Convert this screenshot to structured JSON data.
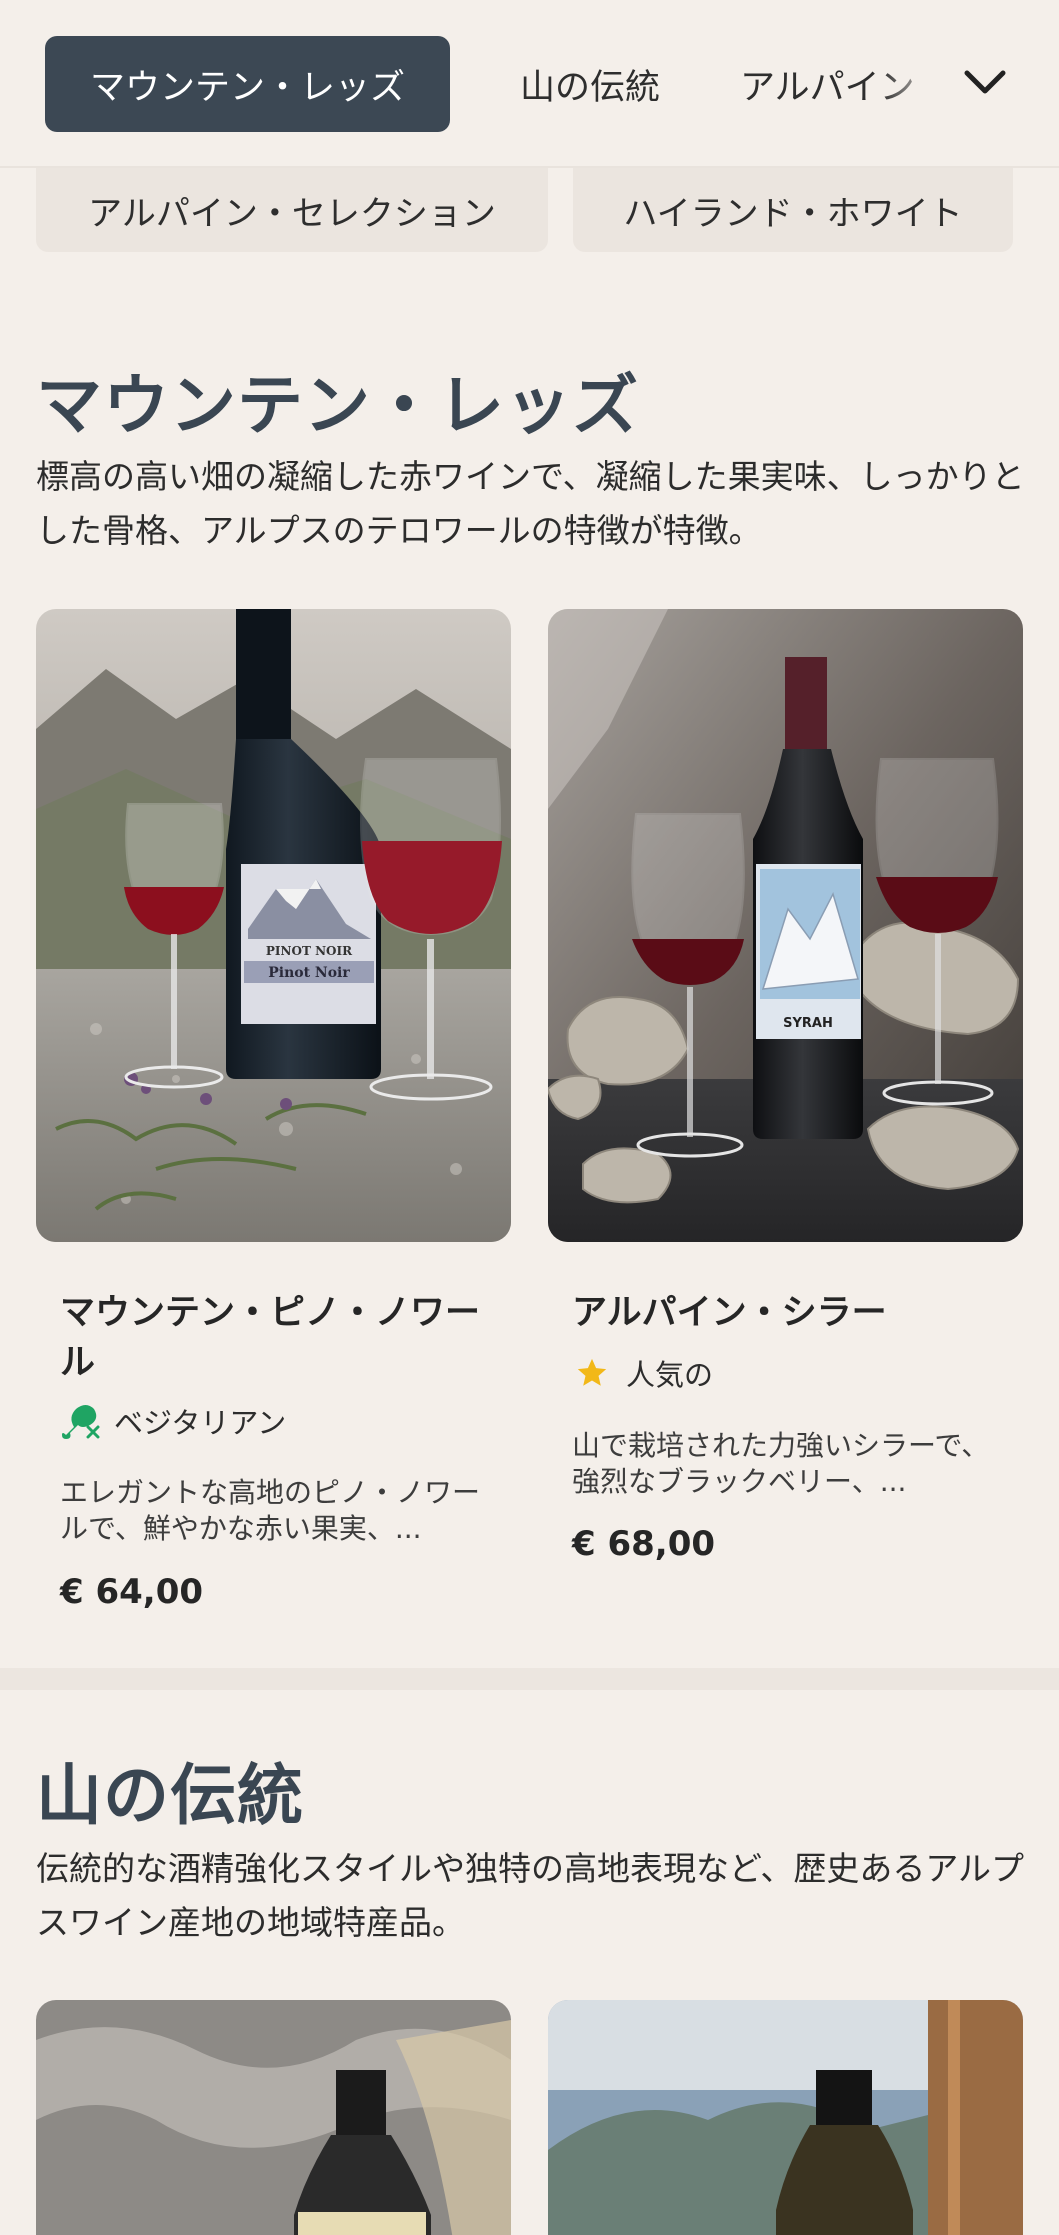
{
  "nav": {
    "tabs": [
      {
        "label": "マウンテン・レッズ",
        "active": true
      },
      {
        "label": "山の伝統",
        "active": false
      },
      {
        "label": "アルパイン",
        "active": false
      }
    ],
    "expand_icon": "chevron-down-icon"
  },
  "chips": [
    {
      "label": "アルパイン・セレクション"
    },
    {
      "label": "ハイランド・ホワイト"
    }
  ],
  "sections": [
    {
      "title": "マウンテン・レッズ",
      "description": "標高の高い畑の凝縮した赤ワインで、凝縮した果実味、しっかりとした骨格、アルプスのテロワールの特徴が特徴。",
      "products": [
        {
          "name": "マウンテン・ピノ・ノワール",
          "tag": "ベジタリアン",
          "tag_icon": "vegetarian-drumstick-icon",
          "description": "エレガントな高地のピノ・ノワールで、鮮やかな赤い果実、...",
          "price": "€ 64,00",
          "label_line1": "PINOT NOIR",
          "label_line2": "Pinot Noir"
        },
        {
          "name": "アルパイン・シラー",
          "tag": "人気の",
          "tag_icon": "star-icon",
          "description": "山で栽培された力強いシラーで、強烈なブラックベリー、...",
          "price": "€ 68,00",
          "label_line1": "SYRAH"
        }
      ]
    },
    {
      "title": "山の伝統",
      "description": "伝統的な酒精強化スタイルや独特の高地表現など、歴史あるアルプスワイン産地の地域特産品。"
    }
  ],
  "colors": {
    "background": "#f4efea",
    "active_tab": "#3c4854",
    "title": "#3a4652",
    "star": "#f2b818",
    "vegetarian": "#1fa463"
  }
}
